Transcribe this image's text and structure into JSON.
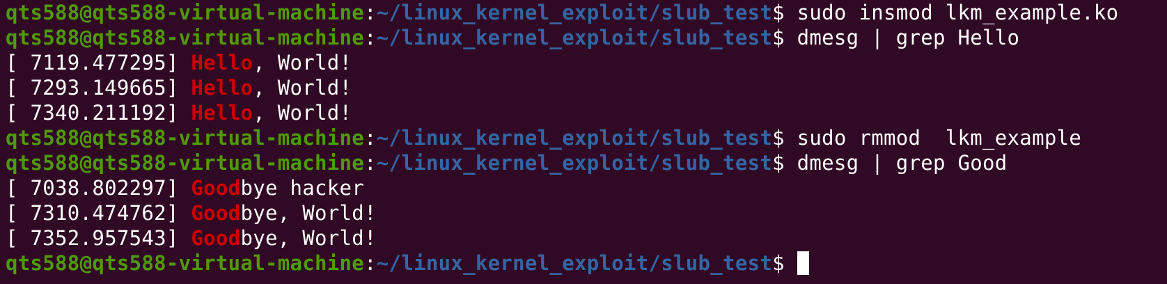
{
  "colors": {
    "background": "#300a24",
    "prompt_user": "#4e9a06",
    "prompt_path": "#3465a4",
    "grep_match": "#cc0000",
    "text": "#ffffff"
  },
  "prompt": {
    "user_host": "qts588@qts588-virtual-machine",
    "separator": ":",
    "path": "~/linux_kernel_exploit/slub_test",
    "symbol": "$ "
  },
  "lines": [
    {
      "type": "prompt",
      "command": "sudo insmod lkm_example.ko"
    },
    {
      "type": "prompt",
      "command": "dmesg | grep Hello"
    },
    {
      "type": "output",
      "timestamp": "[ 7119.477295] ",
      "match": "Hello",
      "rest": ", World!"
    },
    {
      "type": "output",
      "timestamp": "[ 7293.149665] ",
      "match": "Hello",
      "rest": ", World!"
    },
    {
      "type": "output",
      "timestamp": "[ 7340.211192] ",
      "match": "Hello",
      "rest": ", World!"
    },
    {
      "type": "prompt",
      "command": "sudo rmmod  lkm_example"
    },
    {
      "type": "prompt",
      "command": "dmesg | grep Good"
    },
    {
      "type": "output",
      "timestamp": "[ 7038.802297] ",
      "match": "Good",
      "rest": "bye hacker"
    },
    {
      "type": "output",
      "timestamp": "[ 7310.474762] ",
      "match": "Good",
      "rest": "bye, World!"
    },
    {
      "type": "output",
      "timestamp": "[ 7352.957543] ",
      "match": "Good",
      "rest": "bye, World!"
    },
    {
      "type": "prompt",
      "command": "",
      "cursor": true
    }
  ]
}
